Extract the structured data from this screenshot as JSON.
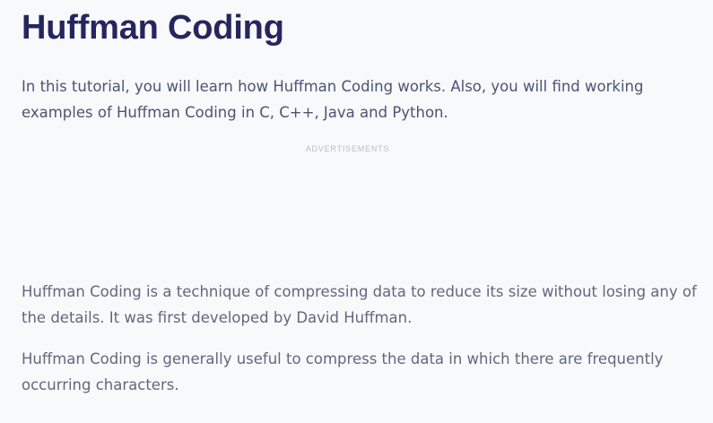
{
  "article": {
    "title": "Huffman Coding",
    "intro": "In this tutorial, you will learn how Huffman Coding works. Also, you will find working examples of Huffman Coding in C, C++, Java and Python.",
    "ad_label": "ADVERTISEMENTS",
    "paragraphs": [
      "Huffman Coding is a technique of compressing data to reduce its size without losing any of the details. It was first developed by David Huffman.",
      "Huffman Coding is generally useful to compress the data in which there are frequently occurring characters."
    ]
  },
  "colors": {
    "background": "#f8f9fb",
    "title": "#25265e",
    "intro_text": "#4d5373",
    "body_text": "#62677d",
    "ad_label": "#b9bcc8"
  }
}
